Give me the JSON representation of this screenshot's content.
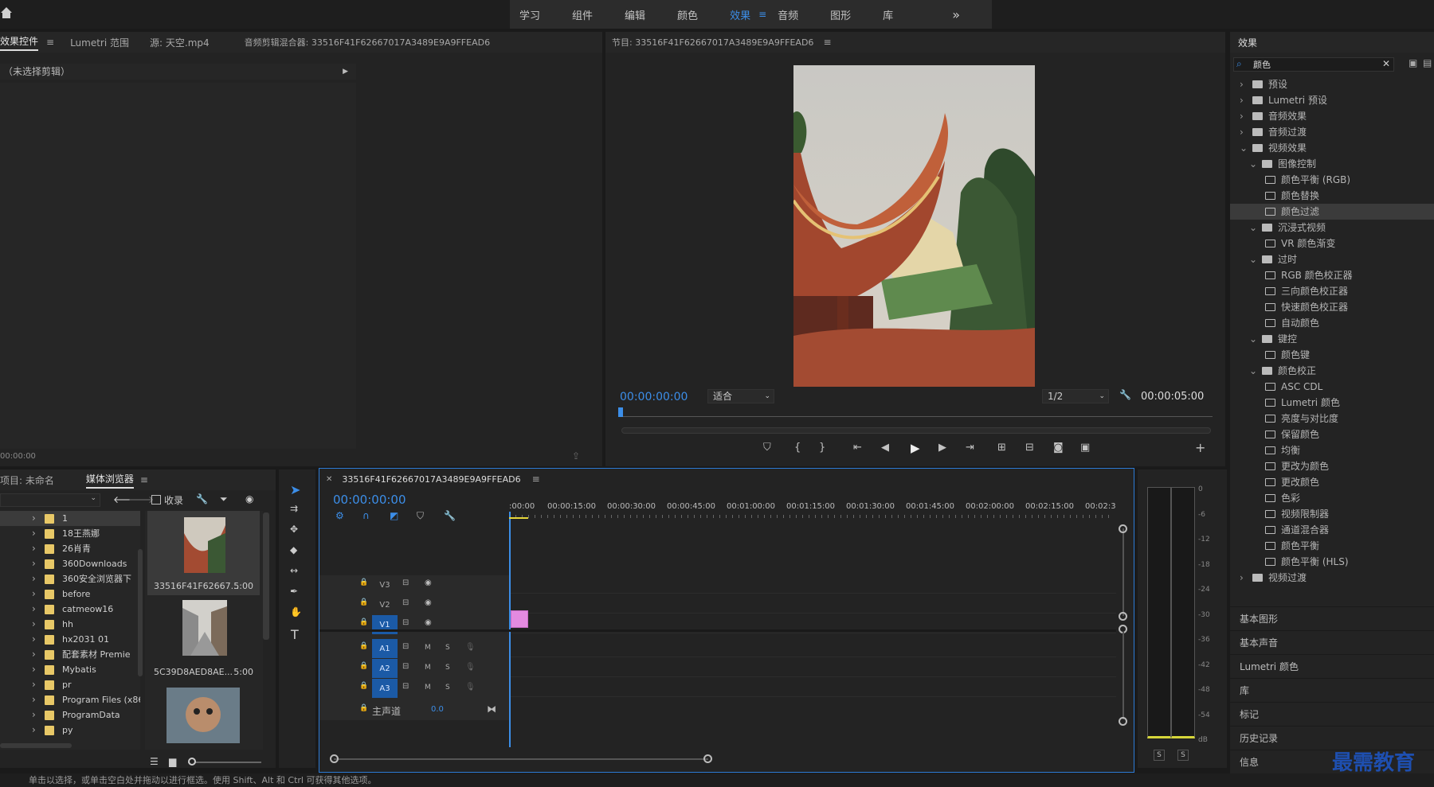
{
  "workspaces": {
    "items": [
      "学习",
      "组件",
      "编辑",
      "颜色",
      "效果",
      "音频",
      "图形",
      "库"
    ],
    "active": "效果",
    "more": "»"
  },
  "effect_controls": {
    "tabs": [
      "效果控件",
      "Lumetri 范围",
      "源: 天空.mp4",
      "音频剪辑混合器: 33516F41F62667017A3489E9A9FFEAD6"
    ],
    "no_clip": "（未选择剪辑）",
    "timecode": "00:00:00"
  },
  "program_monitor": {
    "title": "节目: 33516F41F62667017A3489E9A9FFEAD6",
    "timecode": "00:00:00:00",
    "fit": "适合",
    "resolution": "1/2",
    "duration": "00:00:05:00"
  },
  "effects_panel": {
    "title": "效果",
    "search_value": "颜色",
    "tree": [
      {
        "level": 0,
        "type": "folder",
        "open": false,
        "label": "预设"
      },
      {
        "level": 0,
        "type": "folder",
        "open": false,
        "label": "Lumetri 预设"
      },
      {
        "level": 0,
        "type": "folder",
        "open": false,
        "label": "音频效果"
      },
      {
        "level": 0,
        "type": "folder",
        "open": false,
        "label": "音频过渡"
      },
      {
        "level": 0,
        "type": "folder",
        "open": true,
        "label": "视频效果"
      },
      {
        "level": 1,
        "type": "folder",
        "open": true,
        "label": "图像控制"
      },
      {
        "level": 2,
        "type": "fx",
        "label": "颜色平衡 (RGB)"
      },
      {
        "level": 2,
        "type": "fx",
        "label": "颜色替换"
      },
      {
        "level": 2,
        "type": "fx",
        "label": "颜色过滤",
        "selected": true
      },
      {
        "level": 1,
        "type": "folder",
        "open": true,
        "label": "沉浸式视频"
      },
      {
        "level": 2,
        "type": "fx",
        "label": "VR 颜色渐变"
      },
      {
        "level": 1,
        "type": "folder",
        "open": true,
        "label": "过时"
      },
      {
        "level": 2,
        "type": "fx",
        "label": "RGB 颜色校正器"
      },
      {
        "level": 2,
        "type": "fx",
        "label": "三向颜色校正器"
      },
      {
        "level": 2,
        "type": "fx",
        "label": "快速颜色校正器"
      },
      {
        "level": 2,
        "type": "fx",
        "label": "自动颜色"
      },
      {
        "level": 1,
        "type": "folder",
        "open": true,
        "label": "键控"
      },
      {
        "level": 2,
        "type": "fx",
        "label": "颜色键"
      },
      {
        "level": 1,
        "type": "folder",
        "open": true,
        "label": "颜色校正"
      },
      {
        "level": 2,
        "type": "fx",
        "label": "ASC CDL"
      },
      {
        "level": 2,
        "type": "fx",
        "label": "Lumetri 颜色"
      },
      {
        "level": 2,
        "type": "fx",
        "label": "亮度与对比度"
      },
      {
        "level": 2,
        "type": "fx",
        "label": "保留颜色"
      },
      {
        "level": 2,
        "type": "fx",
        "label": "均衡"
      },
      {
        "level": 2,
        "type": "fx",
        "label": "更改为颜色"
      },
      {
        "level": 2,
        "type": "fx",
        "label": "更改颜色"
      },
      {
        "level": 2,
        "type": "fx",
        "label": "色彩"
      },
      {
        "level": 2,
        "type": "fx",
        "label": "视频限制器"
      },
      {
        "level": 2,
        "type": "fx",
        "label": "通道混合器"
      },
      {
        "level": 2,
        "type": "fx",
        "label": "颜色平衡"
      },
      {
        "level": 2,
        "type": "fx",
        "label": "颜色平衡 (HLS)"
      },
      {
        "level": 0,
        "type": "folder",
        "open": false,
        "label": "视频过渡"
      }
    ],
    "stack_panels": [
      "基本图形",
      "基本声音",
      "Lumetri 颜色",
      "库",
      "标记",
      "历史记录",
      "信息"
    ]
  },
  "project": {
    "tabs": [
      "项目: 未命名",
      "媒体浏览器"
    ],
    "favorites": "收录",
    "folders": [
      "1",
      "18王燕娜",
      "26肖青",
      "360Downloads",
      "360安全浏览器下",
      "before",
      "catmeow16",
      "hh",
      "hx2031 01",
      "配套素材 Premie",
      "Mybatis",
      "pr",
      "Program Files (x86",
      "ProgramData",
      "py"
    ],
    "clips": [
      {
        "name": "33516F41F62667...",
        "duration": "5:00"
      },
      {
        "name": "5C39D8AED8AE...",
        "duration": "5:00"
      },
      {
        "name": "",
        "duration": ""
      }
    ]
  },
  "timeline": {
    "sequence_name": "33516F41F62667017A3489E9A9FFEAD6",
    "timecode": "00:00:00:00",
    "ruler": [
      ":00:00",
      "00:00:15:00",
      "00:00:30:00",
      "00:00:45:00",
      "00:01:00:00",
      "00:01:15:00",
      "00:01:30:00",
      "00:01:45:00",
      "00:02:00:00",
      "00:02:15:00",
      "00:02:3"
    ],
    "video_tracks": [
      "V3",
      "V2",
      "V1"
    ],
    "audio_tracks": [
      "A1",
      "A2",
      "A3"
    ],
    "master": "主声道",
    "master_value": "0.0",
    "m": "M",
    "s": "S"
  },
  "meter": {
    "scale": [
      "0",
      "-6",
      "-12",
      "-18",
      "-24",
      "-30",
      "-36",
      "-42",
      "-48",
      "-54",
      "dB"
    ],
    "solo": [
      "S",
      "S"
    ]
  },
  "status": "单击以选择，或单击空白处并拖动以进行框选。使用 Shift、Alt 和 Ctrl 可获得其他选项。",
  "watermark": "最需教育",
  "colors": {
    "accent": "#3c8ee8",
    "track_active": "#1b5aa6",
    "clip": "#e38ae0"
  }
}
